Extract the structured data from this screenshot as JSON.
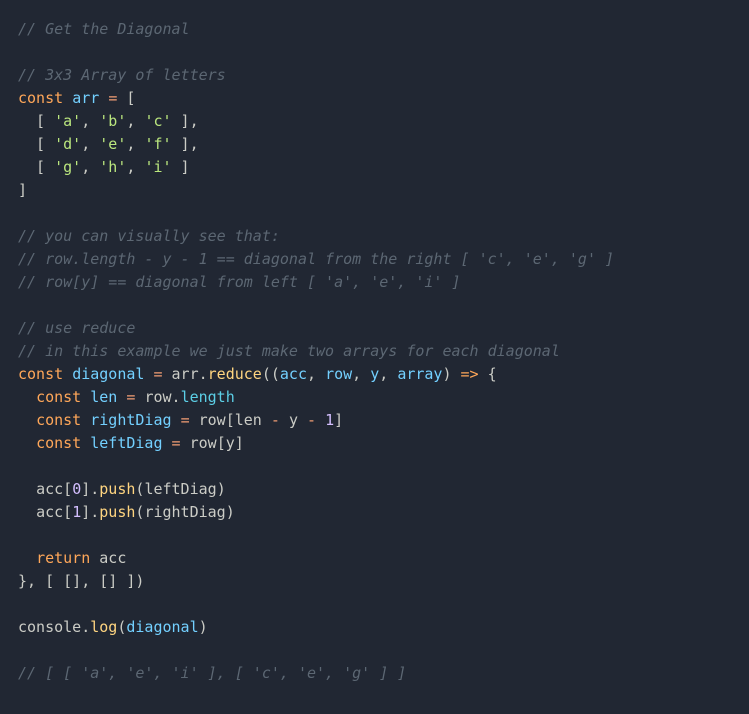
{
  "code": {
    "comment_title": "// Get the Diagonal",
    "comment_arr": "// 3x3 Array of letters",
    "const1": "const",
    "arr_name": "arr",
    "eq": "=",
    "ob": "[",
    "cb": "]",
    "row_open": "  [ ",
    "a": "'a'",
    "b": "'b'",
    "c": "'c'",
    "d": "'d'",
    "e": "'e'",
    "f": "'f'",
    "g": "'g'",
    "h": "'h'",
    "i": "'i'",
    "row_close": " ],",
    "row_close_last": " ]",
    "comment_vis": "// you can visually see that:",
    "comment_right": "// row.length - y - 1 == diagonal from the right [ 'c', 'e', 'g' ]",
    "comment_left": "// row[y] == diagonal from left [ 'a', 'e', 'i' ]",
    "comment_reduce": "// use reduce",
    "comment_example": "// in this example we just make two arrays for each diagonal",
    "diag_name": "diagonal",
    "reduce": "reduce",
    "acc": "acc",
    "row": "row",
    "y": "y",
    "array": "array",
    "arrow": "=>",
    "len": "len",
    "length": "length",
    "rightDiag": "rightDiag",
    "leftDiag": "leftDiag",
    "minus": "-",
    "one": "1",
    "zero": "0",
    "push": "push",
    "return": "return",
    "console": "console",
    "log": "log",
    "comment_result": "// [ [ 'a', 'e', 'i' ], [ 'c', 'e', 'g' ] ]",
    "comma": ", "
  }
}
